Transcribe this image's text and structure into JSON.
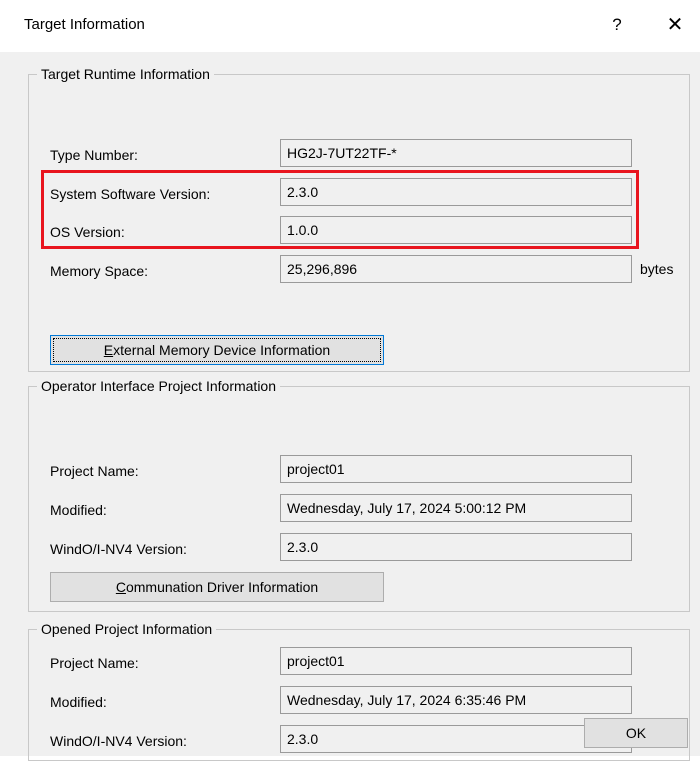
{
  "dialog": {
    "title": "Target Information",
    "help_glyph": "?",
    "close_glyph": "✕"
  },
  "target_runtime": {
    "legend": "Target Runtime Information",
    "type_number_label": "Type Number:",
    "type_number_value": "HG2J-7UT22TF-*",
    "system_software_label": "System Software Version:",
    "system_software_value": "2.3.0",
    "os_version_label": "OS Version:",
    "os_version_value": "1.0.0",
    "memory_space_label": "Memory Space:",
    "memory_space_value": "25,296,896",
    "memory_unit": "bytes",
    "external_memory_button": {
      "mnemonic": "E",
      "rest": "xternal Memory Device Information"
    },
    "highlight_color": "#e8141e"
  },
  "operator_interface": {
    "legend": "Operator Interface Project Information",
    "project_name_label": "Project Name:",
    "project_name_value": "project01",
    "modified_label": "Modified:",
    "modified_value": "Wednesday, July 17, 2024 5:00:12 PM",
    "version_label": "WindO/I-NV4 Version:",
    "version_value": "2.3.0",
    "driver_button": {
      "mnemonic": "C",
      "rest": "ommunation Driver Information"
    }
  },
  "opened_project": {
    "legend": "Opened Project Information",
    "project_name_label": "Project Name:",
    "project_name_value": "project01",
    "modified_label": "Modified:",
    "modified_value": "Wednesday, July 17, 2024 6:35:46 PM",
    "version_label": "WindO/I-NV4 Version:",
    "version_value": "2.3.0"
  },
  "footer": {
    "ok_label": "OK"
  }
}
